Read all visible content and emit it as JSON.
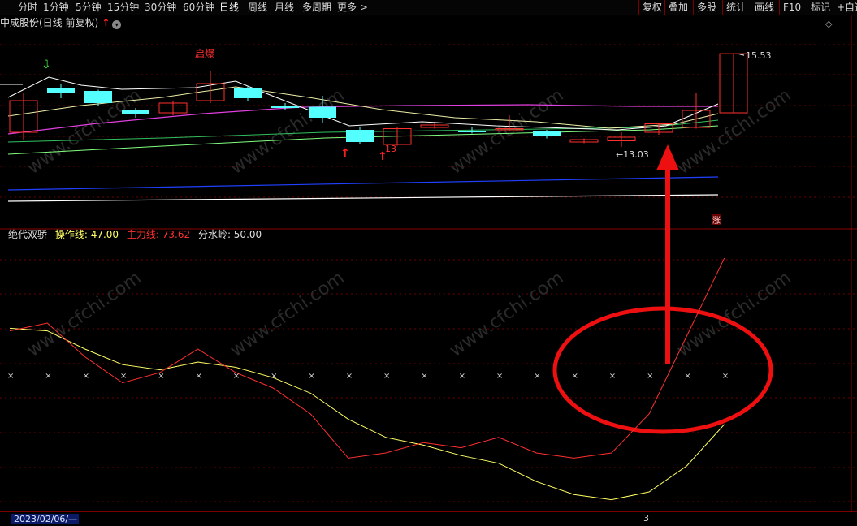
{
  "toolbar": {
    "left_items": [
      "分时",
      "1分钟",
      "5分钟",
      "15分钟",
      "30分钟",
      "60分钟",
      "日线",
      "周线",
      "月线",
      "多周期",
      "更多 >"
    ],
    "active": "日线",
    "right_items": [
      "复权",
      "叠加",
      "多股",
      "统计",
      "画线",
      "F10",
      "标记",
      "+自选"
    ]
  },
  "price_panel": {
    "title": "中成股份(日线 前复权)",
    "high_label": "15.53",
    "low_label": "13.03",
    "annotation_label": "启爆",
    "count_label": "13"
  },
  "indicator_panel": {
    "name": "绝代双骄",
    "lines": [
      {
        "label": "操作线: 47.00",
        "color": "#ffff66"
      },
      {
        "label": "主力线: 73.62",
        "color": "#ff3030"
      },
      {
        "label": "分水岭: 50.00",
        "color": "#dddddd"
      }
    ],
    "marker_glyph": "涨"
  },
  "status": {
    "date": "2023/02/06/—",
    "page": "3"
  },
  "watermark": "www.cfchi.com",
  "colors": {
    "up": "#ff3030",
    "down": "#54ffff",
    "grid": "#6a0000"
  },
  "candles": [
    {
      "o": 12.3,
      "c": 13.6,
      "h": 13.9,
      "l": 12.0
    },
    {
      "o": 14.1,
      "c": 13.9,
      "h": 14.3,
      "l": 13.7
    },
    {
      "o": 14.0,
      "c": 13.5,
      "h": 14.05,
      "l": 13.4
    },
    {
      "o": 13.2,
      "c": 13.05,
      "h": 13.3,
      "l": 12.9
    },
    {
      "o": 13.1,
      "c": 13.5,
      "h": 13.6,
      "l": 13.0
    },
    {
      "o": 13.6,
      "c": 14.3,
      "h": 14.8,
      "l": 13.5
    },
    {
      "o": 14.1,
      "c": 13.7,
      "h": 14.2,
      "l": 13.6
    },
    {
      "o": 13.4,
      "c": 13.3,
      "h": 13.5,
      "l": 13.2
    },
    {
      "o": 13.35,
      "c": 12.9,
      "h": 13.8,
      "l": 12.7
    },
    {
      "o": 12.4,
      "c": 11.9,
      "h": 12.5,
      "l": 11.8
    },
    {
      "o": 11.8,
      "c": 12.45,
      "h": 12.5,
      "l": 11.75
    },
    {
      "o": 12.5,
      "c": 12.6,
      "h": 12.7,
      "l": 12.45
    },
    {
      "o": 12.35,
      "c": 12.3,
      "h": 12.5,
      "l": 12.25
    },
    {
      "o": 12.4,
      "c": 12.45,
      "h": 13.0,
      "l": 12.35
    },
    {
      "o": 12.35,
      "c": 12.15,
      "h": 12.4,
      "l": 12.05
    },
    {
      "o": 11.9,
      "c": 12.0,
      "h": 12.05,
      "l": 11.85
    },
    {
      "o": 11.95,
      "c": 12.1,
      "h": 12.3,
      "l": 11.7
    },
    {
      "o": 12.3,
      "c": 12.65,
      "h": 12.7,
      "l": 12.2
    },
    {
      "o": 12.5,
      "c": 13.2,
      "h": 13.9,
      "l": 12.45
    },
    {
      "o": 13.1,
      "c": 15.53,
      "h": 15.53,
      "l": 13.1
    }
  ],
  "ind_yellow": [
    68,
    67,
    60,
    54,
    52,
    55,
    53,
    49,
    43,
    33,
    26,
    23,
    19,
    16,
    9,
    4,
    2,
    5,
    15,
    31
  ],
  "ind_red": [
    67,
    70,
    57,
    47,
    51,
    60,
    51,
    45,
    35,
    18,
    20,
    24,
    22,
    26,
    20,
    18,
    20,
    35,
    65,
    95
  ]
}
